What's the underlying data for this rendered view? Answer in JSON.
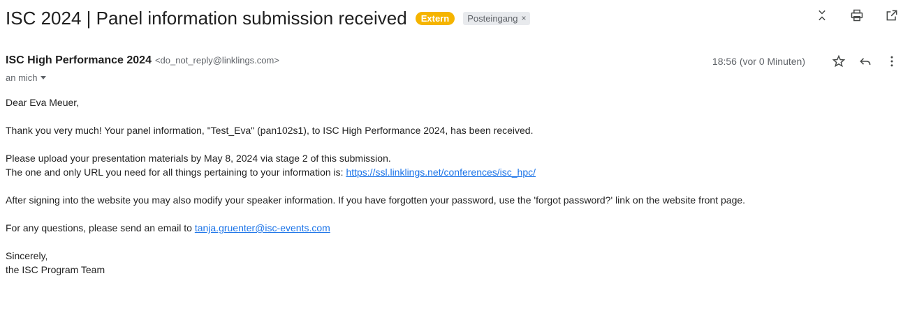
{
  "email": {
    "subject": "ISC 2024 | Panel information submission received",
    "badge_extern": "Extern",
    "label_inbox": "Posteingang",
    "label_remove": "×",
    "sender_name": "ISC High Performance 2024",
    "sender_email": "<do_not_reply@linklings.com>",
    "recipient": "an mich",
    "timestamp": "18:56 (vor 0 Minuten)"
  },
  "icons": {
    "collapse": "collapse-icon",
    "print": "print-icon",
    "open_new_window": "open-in-new-window-icon",
    "star": "star-icon",
    "reply": "reply-icon",
    "more": "more-vert-icon"
  },
  "body": {
    "greeting": "Dear Eva Meuer,",
    "para1": "Thank you very much! Your panel information, \"Test_Eva\" (pan102s1), to ISC High Performance 2024, has been received.",
    "para2_line1": "Please upload your presentation materials by May 8, 2024 via stage 2 of this submission.",
    "para2_line2_prefix": "The one and only URL you need for all things pertaining to your information is: ",
    "url_link": "https://ssl.linklings.net/conferences/isc_hpc/",
    "para3": "After signing into the website you may also modify your speaker information. If you have forgotten your password, use the 'forgot password?' link on the website front page.",
    "para4_prefix": "For any questions, please send an email to ",
    "email_link": "tanja.gruenter@isc-events.com",
    "closing": "Sincerely,",
    "signature": "the ISC Program Team"
  },
  "colors": {
    "extern_badge": "#f5b400",
    "link": "#1a73e8"
  }
}
